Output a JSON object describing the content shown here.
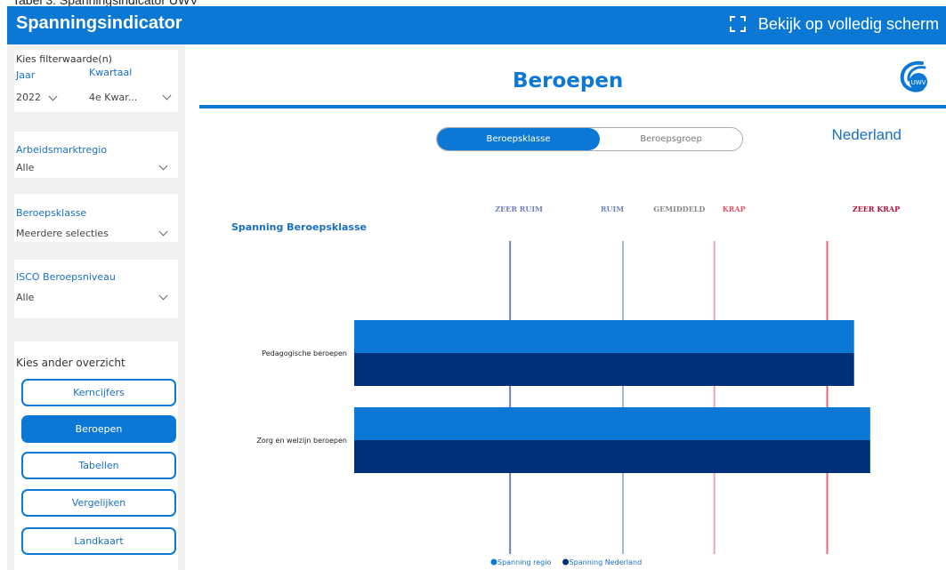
{
  "caption": "Tabel 3: Spanningsindicator UWV",
  "app": {
    "title": "Spanningsindicator",
    "fullscreen_label": "Bekijk op volledig scherm"
  },
  "filters": {
    "heading": "Kies filterwaarde(n)",
    "jaar": {
      "label": "Jaar",
      "value": "2022"
    },
    "kwartaal": {
      "label": "Kwartaal",
      "value": "4e Kwar..."
    },
    "arbeidsmarktregio": {
      "label": "Arbeidsmarktregio",
      "value": "Alle"
    },
    "beroepsklasse": {
      "label": "Beroepsklasse",
      "value": "Meerdere selecties"
    },
    "isco": {
      "label": "ISCO Beroepsniveau",
      "value": "Alle"
    }
  },
  "overview": {
    "heading": "Kies ander overzicht",
    "buttons": [
      "Kerncijfers",
      "Beroepen",
      "Tabellen",
      "Vergelijken",
      "Landkaart"
    ],
    "active": "Beroepen"
  },
  "page": {
    "title": "Beroepen",
    "logo_text": "UWV",
    "toggle": {
      "options": [
        "Beroepsklasse",
        "Beroepsgroep"
      ],
      "selected": "Beroepsklasse"
    },
    "region": "Nederland"
  },
  "chart_data": {
    "type": "bar",
    "orientation": "horizontal",
    "title": "Spanning Beroepsklasse",
    "categories": [
      "Pedagogische beroepen",
      "Zorg en welzijn beroepen"
    ],
    "series": [
      {
        "name": "Spanning regio",
        "values": [
          0.93,
          0.96
        ],
        "color": "#0b78d6"
      },
      {
        "name": "Spanning Nederland",
        "values": [
          0.93,
          0.96
        ],
        "color": "#00307a"
      }
    ],
    "reference_lines": [
      {
        "label": "ZEER RUIM",
        "value": 0.29,
        "color": "#6f83b8"
      },
      {
        "label": "RUIM",
        "value": 0.5,
        "color": "#a8b6d6"
      },
      {
        "label": "GEMIDDELD",
        "value": 0.67,
        "color": "#f2a6b5"
      },
      {
        "label": "KRAP",
        "value": 0.88,
        "color": "#e06a80"
      },
      {
        "label": "ZEER KRAP",
        "value": null,
        "color": "#b0143a"
      }
    ],
    "ref_label_colors": [
      "#6f83b8",
      "#6f83b8",
      "#888888",
      "#e0506a",
      "#b0143a"
    ],
    "legend_position": "bottom",
    "xlim": [
      0,
      1
    ]
  }
}
